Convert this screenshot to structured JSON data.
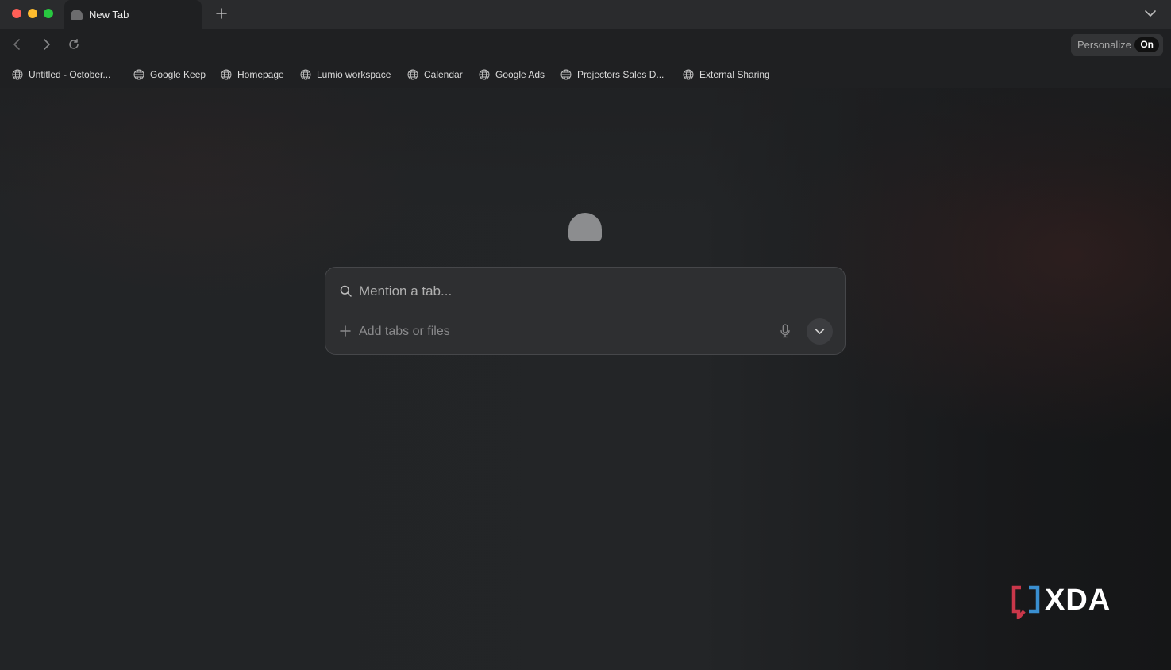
{
  "window": {
    "traffic_lights": [
      "close",
      "minimize",
      "maximize"
    ],
    "colors": {
      "close": "#ff5f57",
      "minimize": "#febc2e",
      "maximize": "#28c840"
    }
  },
  "tabs": [
    {
      "title": "New Tab",
      "active": true,
      "icon": "app-favicon"
    }
  ],
  "toolbar": {
    "back_icon": "chevron-left-icon",
    "forward_icon": "chevron-right-icon",
    "reload_icon": "reload-icon",
    "personalize_label": "Personalize",
    "personalize_state": "On"
  },
  "bookmarks": [
    {
      "label": "Untitled - October...",
      "icon": "globe-icon"
    },
    {
      "label": "Google Keep",
      "icon": "globe-icon"
    },
    {
      "label": "Homepage",
      "icon": "globe-icon"
    },
    {
      "label": "Lumio workspace",
      "icon": "globe-icon"
    },
    {
      "label": "Calendar",
      "icon": "globe-icon"
    },
    {
      "label": "Google Ads",
      "icon": "globe-icon"
    },
    {
      "label": "Projectors Sales D...",
      "icon": "globe-icon"
    },
    {
      "label": "External Sharing",
      "icon": "globe-icon"
    }
  ],
  "composer": {
    "placeholder": "Mention a tab...",
    "value": "",
    "add_label": "Add tabs or files",
    "mic_icon": "microphone-icon",
    "expand_icon": "chevron-down-icon"
  },
  "watermark": {
    "text": "XDA",
    "colors": {
      "red": "#c9374a",
      "blue": "#3a8fd1"
    }
  }
}
